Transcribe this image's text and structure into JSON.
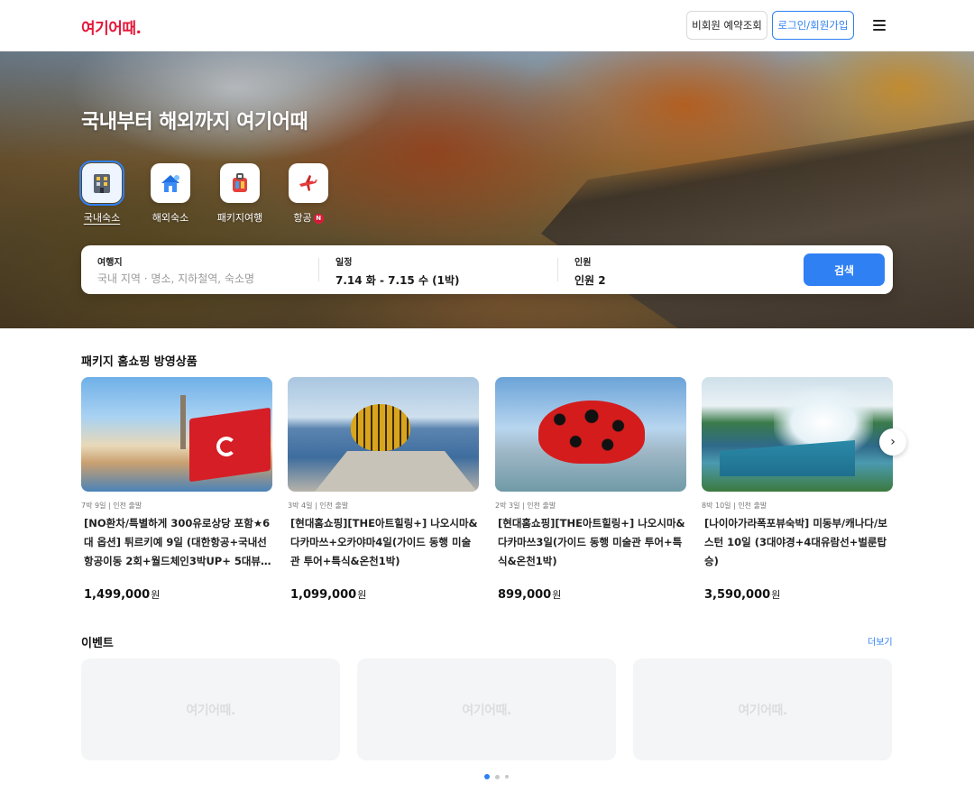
{
  "header": {
    "logo": "여기어때.",
    "guest_reservation": "비회원 예약조회",
    "login_signup": "로그인/회원가입"
  },
  "hero": {
    "title": "국내부터 해외까지 여기어때",
    "categories": [
      {
        "label": "국내숙소",
        "icon": "domestic-stay-icon",
        "active": true
      },
      {
        "label": "해외숙소",
        "icon": "overseas-stay-icon",
        "active": false
      },
      {
        "label": "패키지여행",
        "icon": "package-tour-icon",
        "active": false
      },
      {
        "label": "항공",
        "icon": "airplane-icon",
        "active": false,
        "badge": "N"
      }
    ]
  },
  "search": {
    "destination_label": "여행지",
    "destination_placeholder": "국내 지역 · 명소, 지하철역, 숙소명",
    "schedule_label": "일정",
    "schedule_value": "7.14 화 - 7.15 수 (1박)",
    "guests_label": "인원",
    "guests_value": "인원 2",
    "search_button": "검색"
  },
  "package_section": {
    "title": "패키지 홈쇼핑 방영상품",
    "cards": [
      {
        "meta": "7박 9일 | 인천 출발",
        "title": "[NO환차/특별하게 300유로상당 포함★6대 옵션] 튀르키예 9일 (대한항공+국내선항공이동 2회+월드체인3박UP+ 5대뷰 포...",
        "price": "1,499,000",
        "currency": "원"
      },
      {
        "meta": "3박 4일 | 인천 출발",
        "title": "[현대홈쇼핑][THE아트힐링+] 나오시마&다카마쓰+오카야마4일(가이드 동행 미술관 투어+특식&온천1박)",
        "price": "1,099,000",
        "currency": "원"
      },
      {
        "meta": "2박 3일 | 인천 출발",
        "title": "[현대홈쇼핑][THE아트힐링+] 나오시마&다카마쓰3일(가이드 동행 미술관 투어+특식&온천1박)",
        "price": "899,000",
        "currency": "원"
      },
      {
        "meta": "8박 10일 | 인천 출발",
        "title": "[나이아가라폭포뷰숙박] 미동부/캐나다/보스턴 10일 (3대야경+4대유람선+벌룬탑승)",
        "price": "3,590,000",
        "currency": "원"
      }
    ]
  },
  "events": {
    "title": "이벤트",
    "more": "더보기",
    "placeholder_logo": "여기어때.",
    "page_count": 3,
    "active_page": 1
  },
  "colors": {
    "brand_red": "#e5183a",
    "accent_blue": "#2f80f3"
  }
}
